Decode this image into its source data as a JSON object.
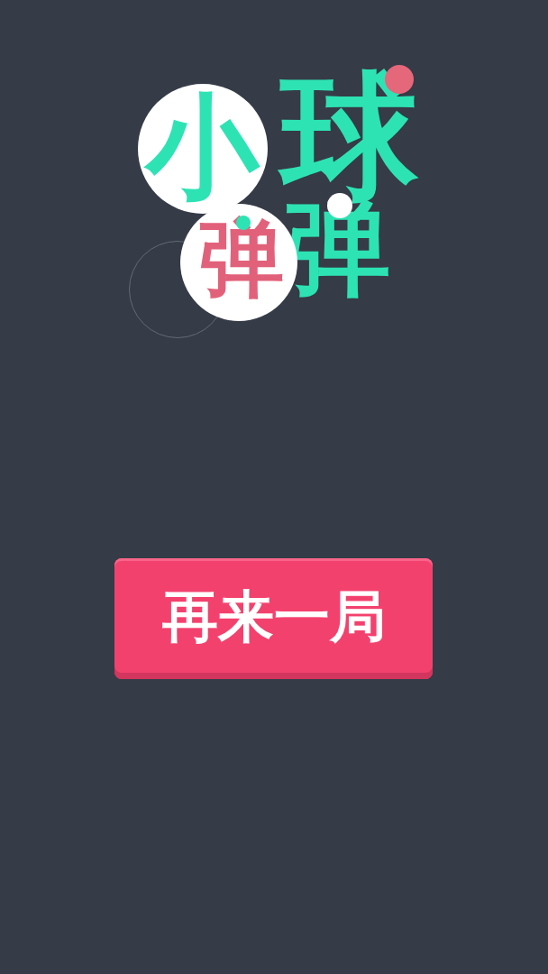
{
  "logo": {
    "characters": [
      {
        "text": "小",
        "color": "#2de3b4",
        "disc": true
      },
      {
        "text": "球",
        "color": "#2de3b4",
        "disc": false
      },
      {
        "text": "弹",
        "color": "#e2617a",
        "disc": true
      },
      {
        "text": "弹",
        "color": "#2de3b4",
        "disc": false
      }
    ],
    "dots": [
      {
        "color": "#e5677a"
      },
      {
        "color": "#2de3b4"
      },
      {
        "color": "#ffffff"
      }
    ]
  },
  "button": {
    "label": "再来一局"
  }
}
